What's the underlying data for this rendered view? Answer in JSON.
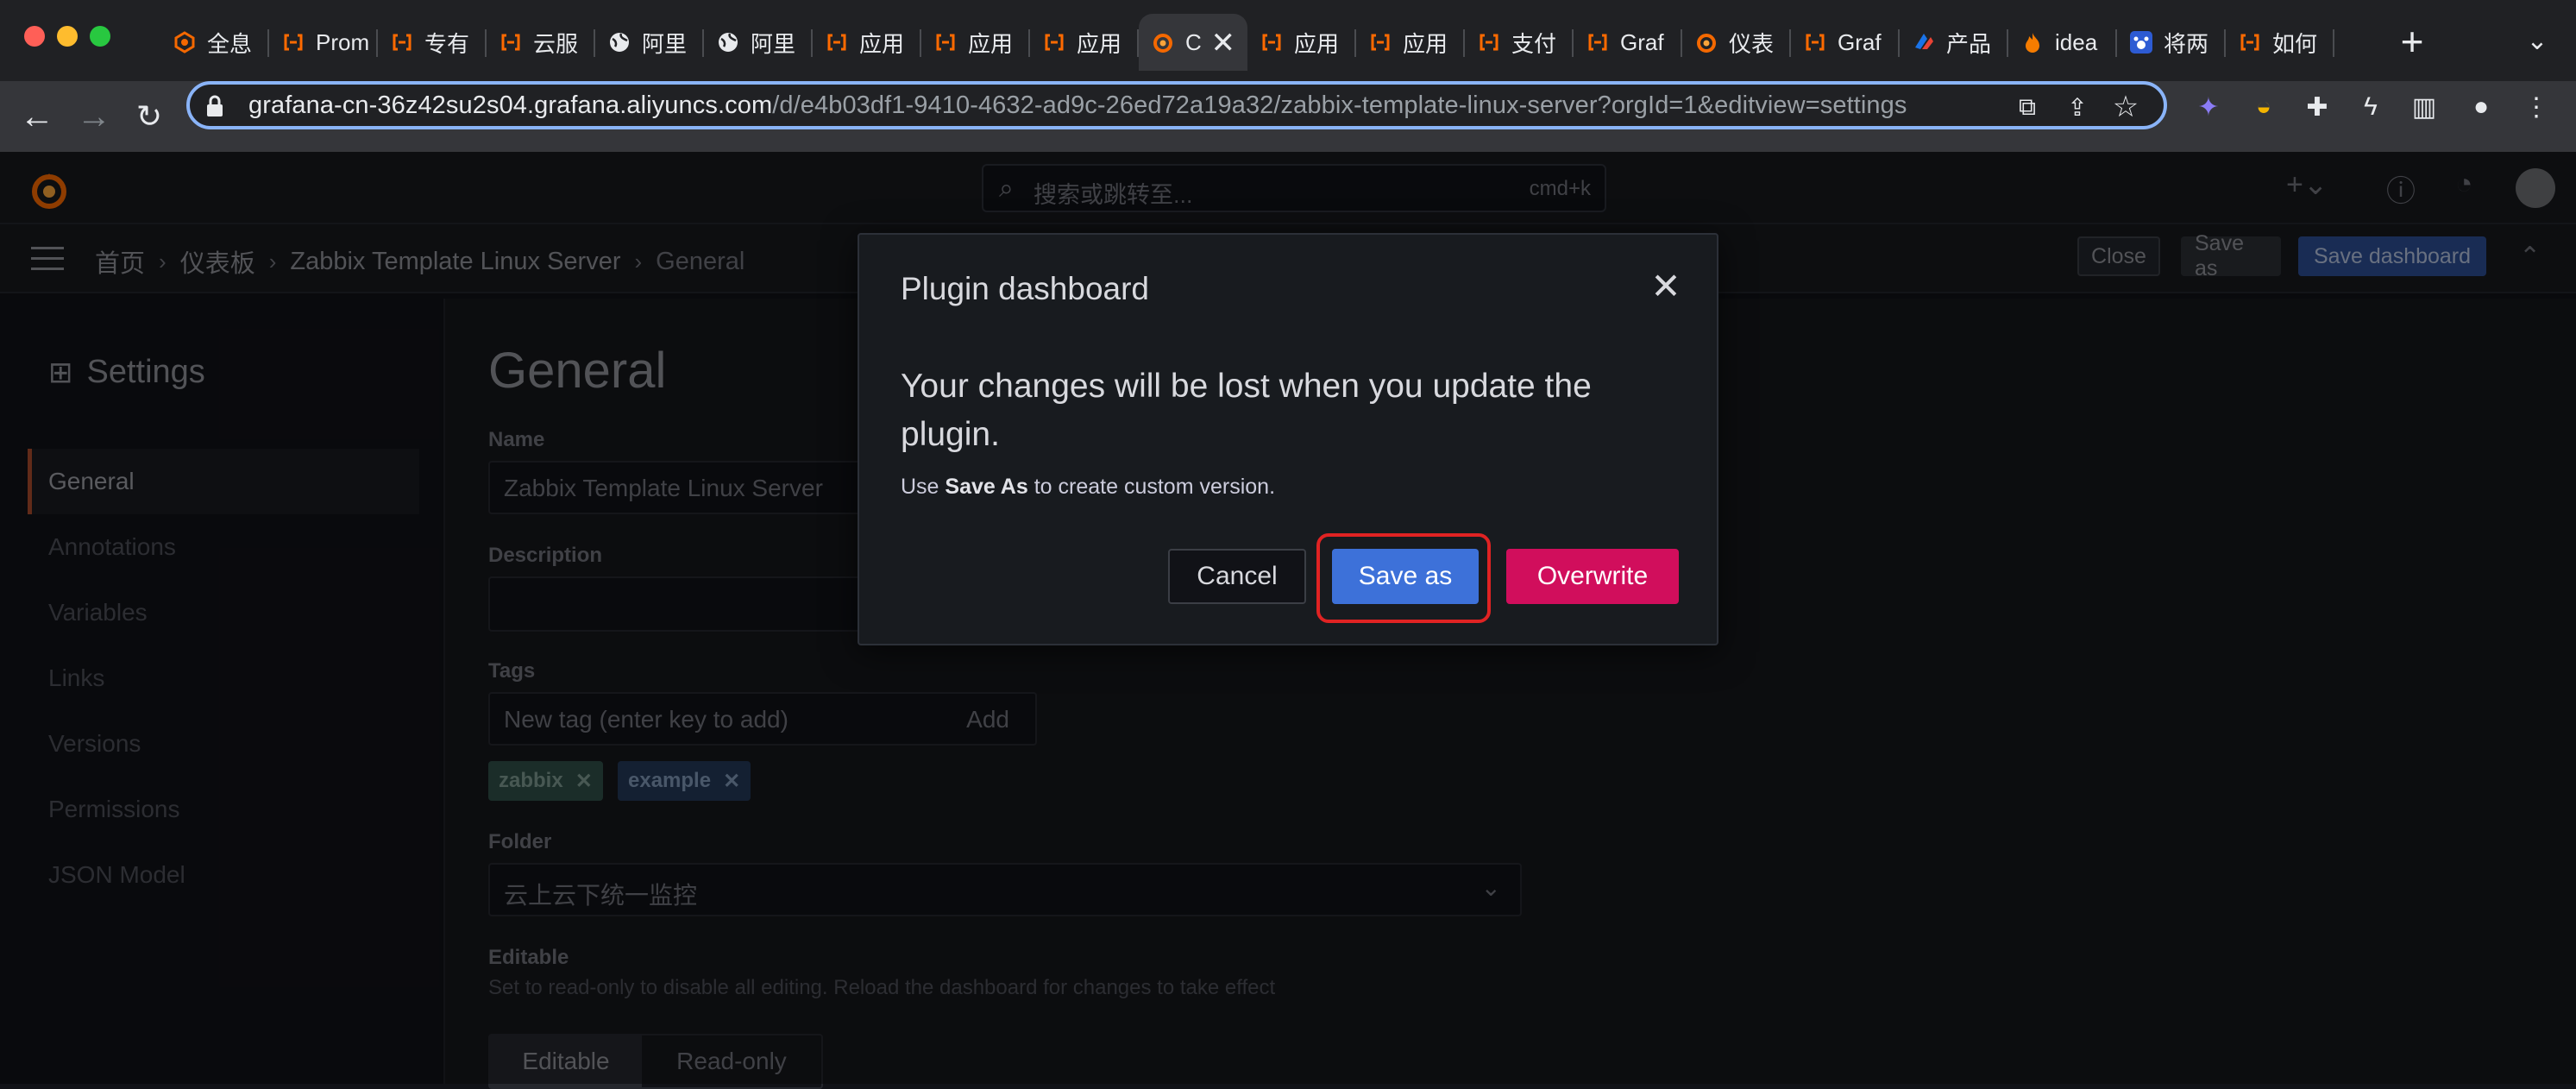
{
  "browser": {
    "tabs": [
      {
        "label": "全息",
        "icon": "grafana-swirl-icon"
      },
      {
        "label": "Prom",
        "icon": "bracket-icon"
      },
      {
        "label": "专有",
        "icon": "bracket-icon"
      },
      {
        "label": "云服",
        "icon": "bracket-icon"
      },
      {
        "label": "阿里",
        "icon": "globe-icon"
      },
      {
        "label": "阿里",
        "icon": "globe-icon"
      },
      {
        "label": "应用",
        "icon": "bracket-icon"
      },
      {
        "label": "应用",
        "icon": "bracket-icon"
      },
      {
        "label": "应用",
        "icon": "bracket-icon"
      },
      {
        "label": "C",
        "icon": "grafana-icon",
        "active": true
      },
      {
        "label": "应用",
        "icon": "bracket-icon"
      },
      {
        "label": "应用",
        "icon": "bracket-icon"
      },
      {
        "label": "支付",
        "icon": "bracket-icon"
      },
      {
        "label": "Graf",
        "icon": "bracket-icon"
      },
      {
        "label": "仪表",
        "icon": "grafana-icon"
      },
      {
        "label": "Graf",
        "icon": "bracket-icon"
      },
      {
        "label": "产品",
        "icon": "stack-icon"
      },
      {
        "label": "idea",
        "icon": "flame-icon"
      },
      {
        "label": "将两",
        "icon": "paw-icon"
      },
      {
        "label": "如何",
        "icon": "bracket-icon"
      }
    ],
    "url_host": "grafana-cn-36z42su2s04.grafana.aliyuncs.com",
    "url_path": "/d/e4b03df1-9410-4632-ad9c-26ed72a19a32/zabbix-template-linux-server?orgId=1&editview=settings",
    "new_tab": "+"
  },
  "grafana": {
    "search_placeholder": "搜索或跳转至...",
    "search_shortcut": "cmd+k",
    "breadcrumbs": [
      "首页",
      "仪表板",
      "Zabbix Template Linux Server",
      "General"
    ],
    "buttons": {
      "close": "Close",
      "save_as": "Save as",
      "save_dashboard": "Save dashboard"
    },
    "settings_title": "Settings",
    "nav": [
      "General",
      "Annotations",
      "Variables",
      "Links",
      "Versions",
      "Permissions",
      "JSON Model"
    ],
    "page_title": "General",
    "name_label": "Name",
    "name_value": "Zabbix Template Linux Server",
    "description_label": "Description",
    "tags_label": "Tags",
    "tags_placeholder": "New tag (enter key to add)",
    "tags_add": "Add",
    "tags": [
      "zabbix",
      "example"
    ],
    "folder_label": "Folder",
    "folder_value": "云上云下统一监控",
    "editable_label": "Editable",
    "editable_desc": "Set to read-only to disable all editing. Reload the dashboard for changes to take effect",
    "editable_options": [
      "Editable",
      "Read-only"
    ]
  },
  "modal": {
    "title": "Plugin dashboard",
    "message": "Your changes will be lost when you update the plugin.",
    "sub_prefix": "Use ",
    "sub_bold": "Save As",
    "sub_suffix": " to create custom version.",
    "cancel": "Cancel",
    "save_as": "Save as",
    "overwrite": "Overwrite"
  },
  "colors": {
    "accent_blue": "#3d71d9",
    "overwrite_pink": "#d10e5c",
    "highlight_red": "#e02323"
  }
}
